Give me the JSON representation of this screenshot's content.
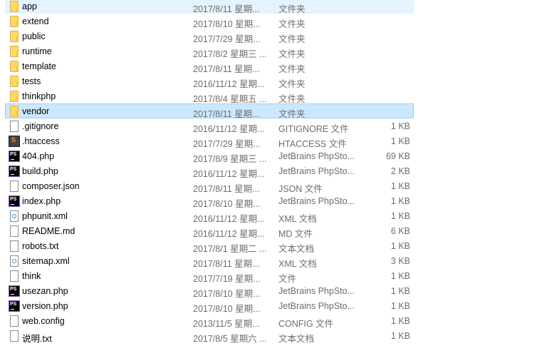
{
  "files": [
    {
      "name": "app",
      "date": "2017/8/11 星期...",
      "type": "文件夹",
      "size": "",
      "icon": "folder-icon",
      "state": "hover"
    },
    {
      "name": "extend",
      "date": "2017/8/10 星期...",
      "type": "文件夹",
      "size": "",
      "icon": "folder-icon"
    },
    {
      "name": "public",
      "date": "2017/7/29 星期...",
      "type": "文件夹",
      "size": "",
      "icon": "folder-icon"
    },
    {
      "name": "runtime",
      "date": "2017/8/2 星期三 ...",
      "type": "文件夹",
      "size": "",
      "icon": "folder-icon"
    },
    {
      "name": "template",
      "date": "2017/8/11 星期...",
      "type": "文件夹",
      "size": "",
      "icon": "folder-icon"
    },
    {
      "name": "tests",
      "date": "2016/11/12 星期...",
      "type": "文件夹",
      "size": "",
      "icon": "folder-icon"
    },
    {
      "name": "thinkphp",
      "date": "2017/8/4 星期五 ...",
      "type": "文件夹",
      "size": "",
      "icon": "folder-icon"
    },
    {
      "name": "vendor",
      "date": "2017/8/11 星期...",
      "type": "文件夹",
      "size": "",
      "icon": "folder-icon",
      "state": "selected"
    },
    {
      "name": ".gitignore",
      "date": "2016/11/12 星期...",
      "type": "GITIGNORE 文件",
      "size": "1 KB",
      "icon": "file-icon"
    },
    {
      "name": ".htaccess",
      "date": "2017/7/29 星期...",
      "type": "HTACCESS 文件",
      "size": "1 KB",
      "icon": "sublime-file-icon"
    },
    {
      "name": "404.php",
      "date": "2017/8/9 星期三 ...",
      "type": "JetBrains PhpSto...",
      "size": "69 KB",
      "icon": "phpstorm-file-icon"
    },
    {
      "name": "build.php",
      "date": "2016/11/12 星期...",
      "type": "JetBrains PhpSto...",
      "size": "2 KB",
      "icon": "phpstorm-file-icon"
    },
    {
      "name": "composer.json",
      "date": "2017/8/11 星期...",
      "type": "JSON 文件",
      "size": "1 KB",
      "icon": "file-icon"
    },
    {
      "name": "index.php",
      "date": "2017/8/10 星期...",
      "type": "JetBrains PhpSto...",
      "size": "1 KB",
      "icon": "phpstorm-file-icon"
    },
    {
      "name": "phpunit.xml",
      "date": "2016/11/12 星期...",
      "type": "XML 文档",
      "size": "1 KB",
      "icon": "xml-file-icon"
    },
    {
      "name": "README.md",
      "date": "2016/11/12 星期...",
      "type": "MD 文件",
      "size": "6 KB",
      "icon": "file-icon"
    },
    {
      "name": "robots.txt",
      "date": "2017/8/1 星期二 ...",
      "type": "文本文档",
      "size": "1 KB",
      "icon": "file-icon"
    },
    {
      "name": "sitemap.xml",
      "date": "2017/8/11 星期...",
      "type": "XML 文档",
      "size": "3 KB",
      "icon": "xml-file-icon"
    },
    {
      "name": "think",
      "date": "2017/7/19 星期...",
      "type": "文件",
      "size": "1 KB",
      "icon": "file-icon"
    },
    {
      "name": "usezan.php",
      "date": "2017/8/10 星期...",
      "type": "JetBrains PhpSto...",
      "size": "1 KB",
      "icon": "phpstorm-file-icon"
    },
    {
      "name": "version.php",
      "date": "2017/8/10 星期...",
      "type": "JetBrains PhpSto...",
      "size": "1 KB",
      "icon": "phpstorm-file-icon"
    },
    {
      "name": "web.config",
      "date": "2013/11/5 星期...",
      "type": "CONFIG 文件",
      "size": "1 KB",
      "icon": "file-icon"
    },
    {
      "name": "说明.txt",
      "date": "2017/8/5 星期六 ...",
      "type": "文本文档",
      "size": "1 KB",
      "icon": "file-icon"
    }
  ],
  "colors": {
    "hover": "#e5f3ff",
    "selected": "#cce8ff",
    "selected_border": "#99d1ff",
    "secondary_text": "#6d6d6d"
  }
}
